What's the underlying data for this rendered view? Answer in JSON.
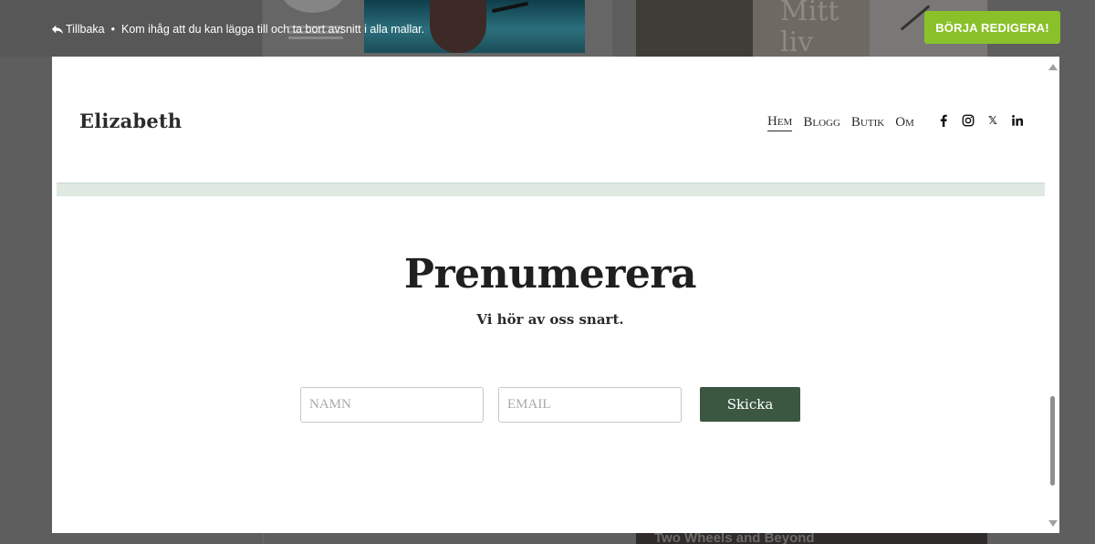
{
  "topbar": {
    "back_label": "Tillbaka",
    "separator": "•",
    "message": "Kom ihåg att du kan lägga till och ta bort avsnitt i alla mallar.",
    "start_editing_label": "BÖRJA REDIGERA!"
  },
  "background": {
    "card3_text": "Mitt liv",
    "card4_text": "Two Wheels and Beyond"
  },
  "site": {
    "logo": "Elizabeth",
    "nav": [
      {
        "label": "Hem",
        "active": true
      },
      {
        "label": "Blogg",
        "active": false
      },
      {
        "label": "Butik",
        "active": false
      },
      {
        "label": "Om",
        "active": false
      }
    ],
    "socials": [
      "facebook-icon",
      "instagram-icon",
      "x-icon",
      "linkedin-icon"
    ]
  },
  "subscribe": {
    "title": "Prenumerera",
    "subtitle": "Vi hör av oss snart.",
    "name_placeholder": "NAMN",
    "email_placeholder": "EMAIL",
    "send_label": "Skicka"
  },
  "colors": {
    "accent_button": "#8ac12a",
    "send_button": "#3b5742",
    "band": "#dfe9e1"
  }
}
